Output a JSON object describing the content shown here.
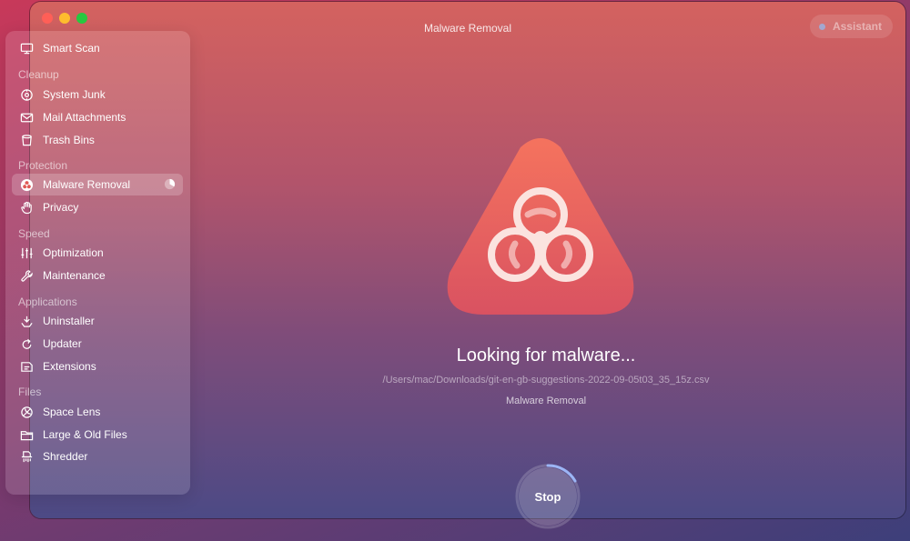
{
  "window": {
    "title": "Malware Removal",
    "assistant_label": "Assistant"
  },
  "sidebar": {
    "top_item": {
      "label": "Smart Scan",
      "icon": "monitor-icon"
    },
    "sections": [
      {
        "label": "Cleanup",
        "items": [
          {
            "label": "System Junk",
            "icon": "hard-drive-icon"
          },
          {
            "label": "Mail Attachments",
            "icon": "envelope-icon"
          },
          {
            "label": "Trash Bins",
            "icon": "trash-icon"
          }
        ]
      },
      {
        "label": "Protection",
        "items": [
          {
            "label": "Malware Removal",
            "icon": "biohazard-icon",
            "active": true
          },
          {
            "label": "Privacy",
            "icon": "hand-icon"
          }
        ]
      },
      {
        "label": "Speed",
        "items": [
          {
            "label": "Optimization",
            "icon": "sliders-icon"
          },
          {
            "label": "Maintenance",
            "icon": "wrench-icon"
          }
        ]
      },
      {
        "label": "Applications",
        "items": [
          {
            "label": "Uninstaller",
            "icon": "uninstaller-icon"
          },
          {
            "label": "Updater",
            "icon": "updater-icon"
          },
          {
            "label": "Extensions",
            "icon": "extensions-icon"
          }
        ]
      },
      {
        "label": "Files",
        "items": [
          {
            "label": "Space Lens",
            "icon": "space-lens-icon"
          },
          {
            "label": "Large & Old Files",
            "icon": "folder-icon"
          },
          {
            "label": "Shredder",
            "icon": "shredder-icon"
          }
        ]
      }
    ]
  },
  "main": {
    "hero_icon": "biohazard-triangle-icon",
    "status_title": "Looking for malware...",
    "current_path": "/Users/mac/Downloads/git-en-gb-suggestions-2022-09-05t03_35_15z.csv",
    "module_label": "Malware Removal",
    "stop_label": "Stop"
  },
  "colors": {
    "accent": "#ff5f57",
    "hero_triangle": "#ef6a5e",
    "window_gradient_top": "#d4625f",
    "window_gradient_bottom": "#4c4a85"
  }
}
